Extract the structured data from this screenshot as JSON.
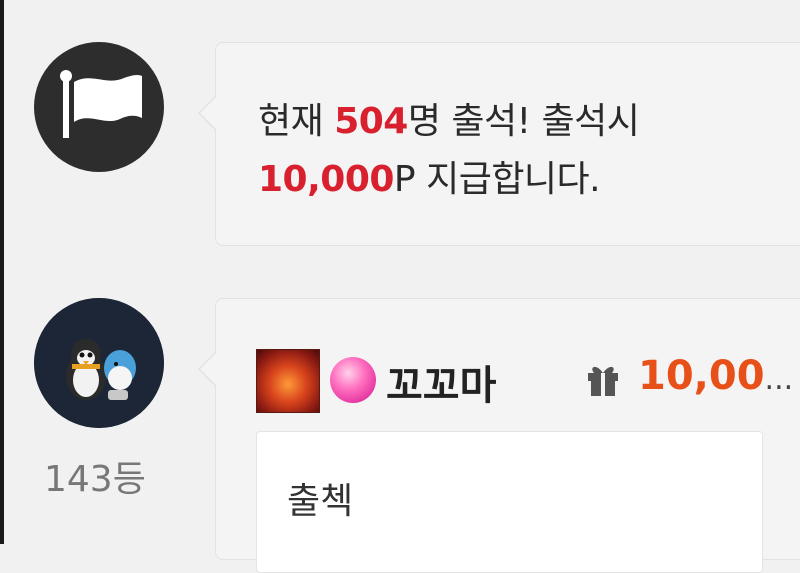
{
  "notice": {
    "prefix": "현재 ",
    "count": "504",
    "middle": "명 출석! 출석시",
    "points": "10,000",
    "suffix": "P 지급합니다."
  },
  "comment": {
    "username": "꼬꼬마",
    "points_visible": "10,00",
    "points_ellipsis": "...",
    "text": "출첵",
    "rank": "143등"
  },
  "icons": {
    "notice_avatar": "flag-icon",
    "gift": "gift-icon",
    "level_badge": "dragon-badge-icon",
    "candy": "candy-icon"
  },
  "colors": {
    "highlight_red": "#d8202e",
    "points_orange": "#e8501a"
  }
}
